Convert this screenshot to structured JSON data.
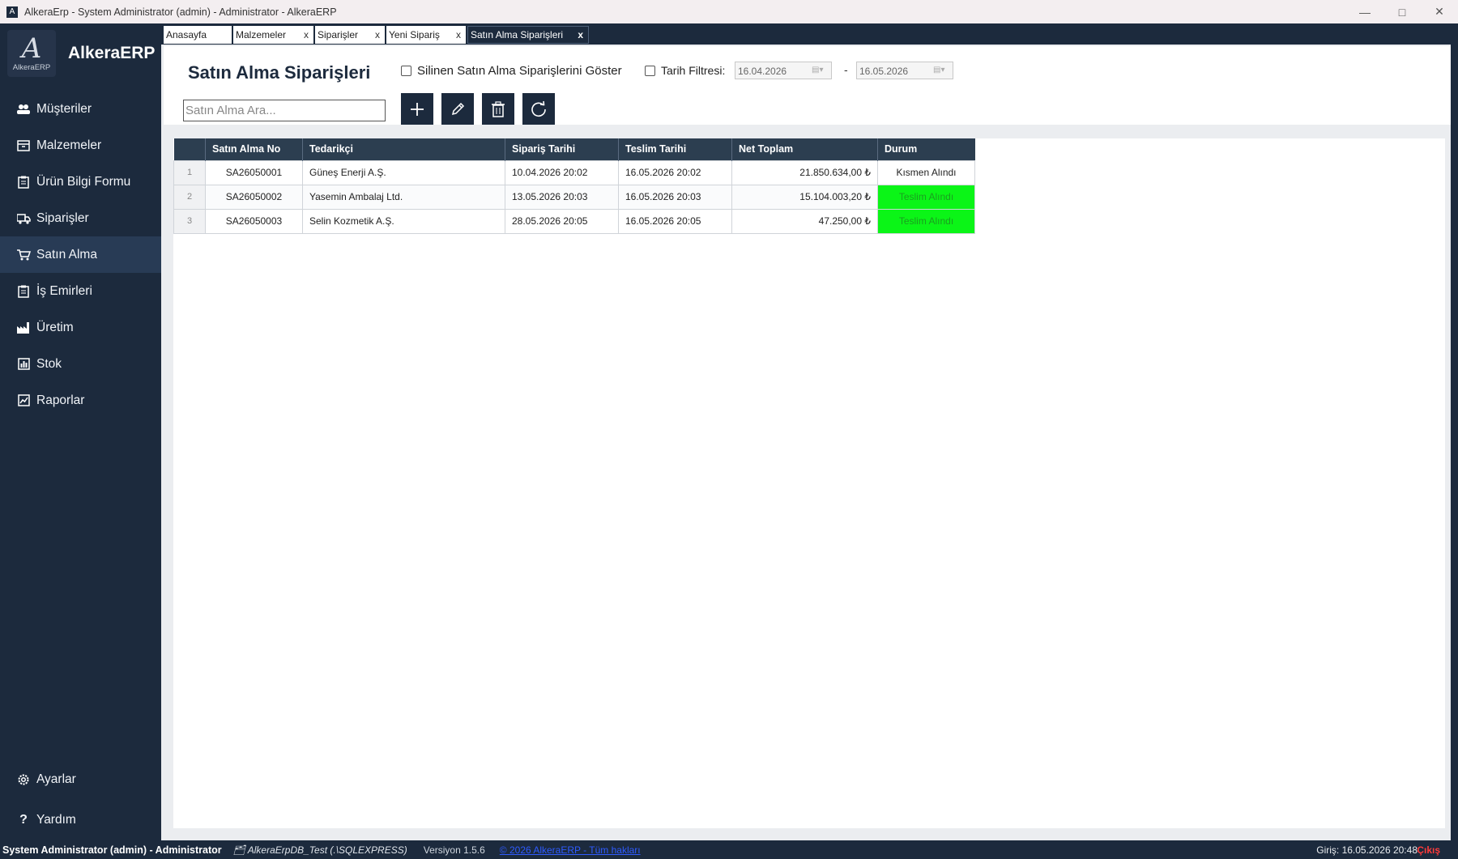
{
  "window": {
    "title": "AlkeraErp - System Administrator (admin) - Administrator - AlkeraERP",
    "app_icon": "A"
  },
  "brand": {
    "logo_text": "AlkeraERP",
    "name": "AlkeraERP"
  },
  "sidebar": {
    "items": [
      {
        "label": "Müşteriler",
        "icon": "users-icon"
      },
      {
        "label": "Malzemeler",
        "icon": "box-icon"
      },
      {
        "label": "Ürün Bilgi Formu",
        "icon": "clipboard-icon"
      },
      {
        "label": "Siparişler",
        "icon": "truck-icon"
      },
      {
        "label": "Satın Alma",
        "icon": "cart-icon"
      },
      {
        "label": "İş Emirleri",
        "icon": "clipboard-list-icon"
      },
      {
        "label": "Üretim",
        "icon": "factory-icon"
      },
      {
        "label": "Stok",
        "icon": "bar-chart-icon"
      },
      {
        "label": "Raporlar",
        "icon": "line-chart-icon"
      }
    ],
    "active_index": 4,
    "bottom": [
      {
        "label": "Ayarlar",
        "icon": "gear-icon"
      },
      {
        "label": "Yardım",
        "icon": "question-icon"
      }
    ]
  },
  "tabs": [
    {
      "label": "Anasayfa",
      "closable": false
    },
    {
      "label": "Malzemeler",
      "closable": true
    },
    {
      "label": "Siparişler",
      "closable": true
    },
    {
      "label": "Yeni Sipariş",
      "closable": true
    },
    {
      "label": "Satın Alma Siparişleri",
      "closable": true,
      "active": true
    }
  ],
  "tab_close_glyph": "x",
  "page": {
    "title": "Satın Alma Siparişleri",
    "show_deleted_label": "Silinen Satın Alma Siparişlerini Göster",
    "date_filter_label": "Tarih Filtresi:",
    "date_from": "16.04.2026",
    "date_to": "16.05.2026",
    "date_separator": "-",
    "search_placeholder": "Satın Alma Ara..."
  },
  "table": {
    "columns": [
      "Satın Alma No",
      "Tedarikçi",
      "Sipariş Tarihi",
      "Teslim Tarihi",
      "Net Toplam",
      "Durum"
    ],
    "rows": [
      {
        "no": "1",
        "po": "SA26050001",
        "supplier": "Güneş Enerji A.Ş.",
        "order_date": "10.04.2026 20:02",
        "delivery_date": "16.05.2026 20:02",
        "total": "21.850.634,00 ₺",
        "status": "Kısmen Alındı",
        "status_color": ""
      },
      {
        "no": "2",
        "po": "SA26050002",
        "supplier": "Yasemin Ambalaj Ltd.",
        "order_date": "13.05.2026 20:03",
        "delivery_date": "16.05.2026 20:03",
        "total": "15.104.003,20 ₺",
        "status": "Teslim Alındı",
        "status_color": "#0bf517"
      },
      {
        "no": "3",
        "po": "SA26050003",
        "supplier": "Selin Kozmetik A.Ş.",
        "order_date": "28.05.2026 20:05",
        "delivery_date": "16.05.2026 20:05",
        "total": "47.250,00 ₺",
        "status": "Teslim Alındı",
        "status_color": "#0bf517"
      }
    ]
  },
  "statusbar": {
    "user": "System Administrator (admin) - Administrator",
    "db": "AlkeraErpDB_Test (.\\SQLEXPRESS)",
    "version": "Versiyon 1.5.6",
    "link": "© 2026 AlkeraERP - Tüm hakları",
    "login": "Giriş: 16.05.2026 20:48",
    "logout": "Çıkış"
  },
  "colors": {
    "sidebar_bg": "#1c2a3d",
    "active_item_bg": "#283b55",
    "header_row_bg": "#2c3e50",
    "status_green": "#0bf517"
  }
}
